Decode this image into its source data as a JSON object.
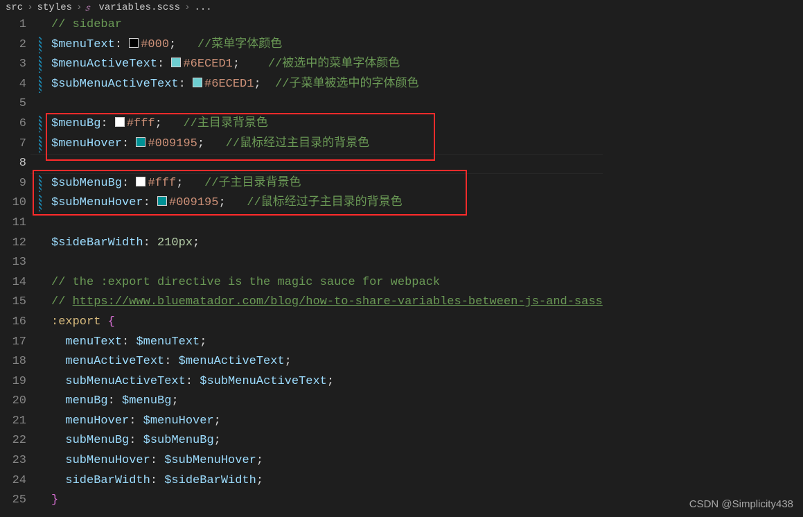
{
  "breadcrumb": {
    "folder1": "src",
    "folder2": "styles",
    "file": "variables.scss",
    "tail": "..."
  },
  "lines": {
    "cmt1": "// sidebar",
    "l2": {
      "var": "$menuText",
      "hex": "#000",
      "cmt": "//菜单字体颜色"
    },
    "l3": {
      "var": "$menuActiveText",
      "hex": "#6ECED1",
      "cmt": "//被选中的菜单字体颜色"
    },
    "l4": {
      "var": "$subMenuActiveText",
      "hex": "#6ECED1",
      "cmt": "//子菜单被选中的字体颜色"
    },
    "l6": {
      "var": "$menuBg",
      "hex": "#fff",
      "cmt": "//主目录背景色"
    },
    "l7": {
      "var": "$menuHover",
      "hex": "#009195",
      "cmt": "//鼠标经过主目录的背景色"
    },
    "l9": {
      "var": "$subMenuBg",
      "hex": "#fff",
      "cmt": "//子主目录背景色"
    },
    "l10": {
      "var": "$subMenuHover",
      "hex": "#009195",
      "cmt": "//鼠标经过子主目录的背景色"
    },
    "l12": {
      "var": "$sideBarWidth",
      "num": "210px"
    },
    "cmt14": "// the :export directive is the magic sauce for webpack",
    "cmt15a": "// ",
    "cmt15b": "https://www.bluematador.com/blog/how-to-share-variables-between-js-and-sass",
    "l16": {
      "sel": ":export",
      "open": "{"
    },
    "l17": {
      "prop": "menuText",
      "val": "$menuText"
    },
    "l18": {
      "prop": "menuActiveText",
      "val": "$menuActiveText"
    },
    "l19": {
      "prop": "subMenuActiveText",
      "val": "$subMenuActiveText"
    },
    "l20": {
      "prop": "menuBg",
      "val": "$menuBg"
    },
    "l21": {
      "prop": "menuHover",
      "val": "$menuHover"
    },
    "l22": {
      "prop": "subMenuBg",
      "val": "$subMenuBg"
    },
    "l23": {
      "prop": "subMenuHover",
      "val": "$subMenuHover"
    },
    "l24": {
      "prop": "sideBarWidth",
      "val": "$sideBarWidth"
    },
    "l25": "}"
  },
  "line_numbers": [
    "1",
    "2",
    "3",
    "4",
    "5",
    "6",
    "7",
    "8",
    "9",
    "10",
    "11",
    "12",
    "13",
    "14",
    "15",
    "16",
    "17",
    "18",
    "19",
    "20",
    "21",
    "22",
    "23",
    "24",
    "25"
  ],
  "current_line_index": 7,
  "watermark": "CSDN @Simplicity438"
}
